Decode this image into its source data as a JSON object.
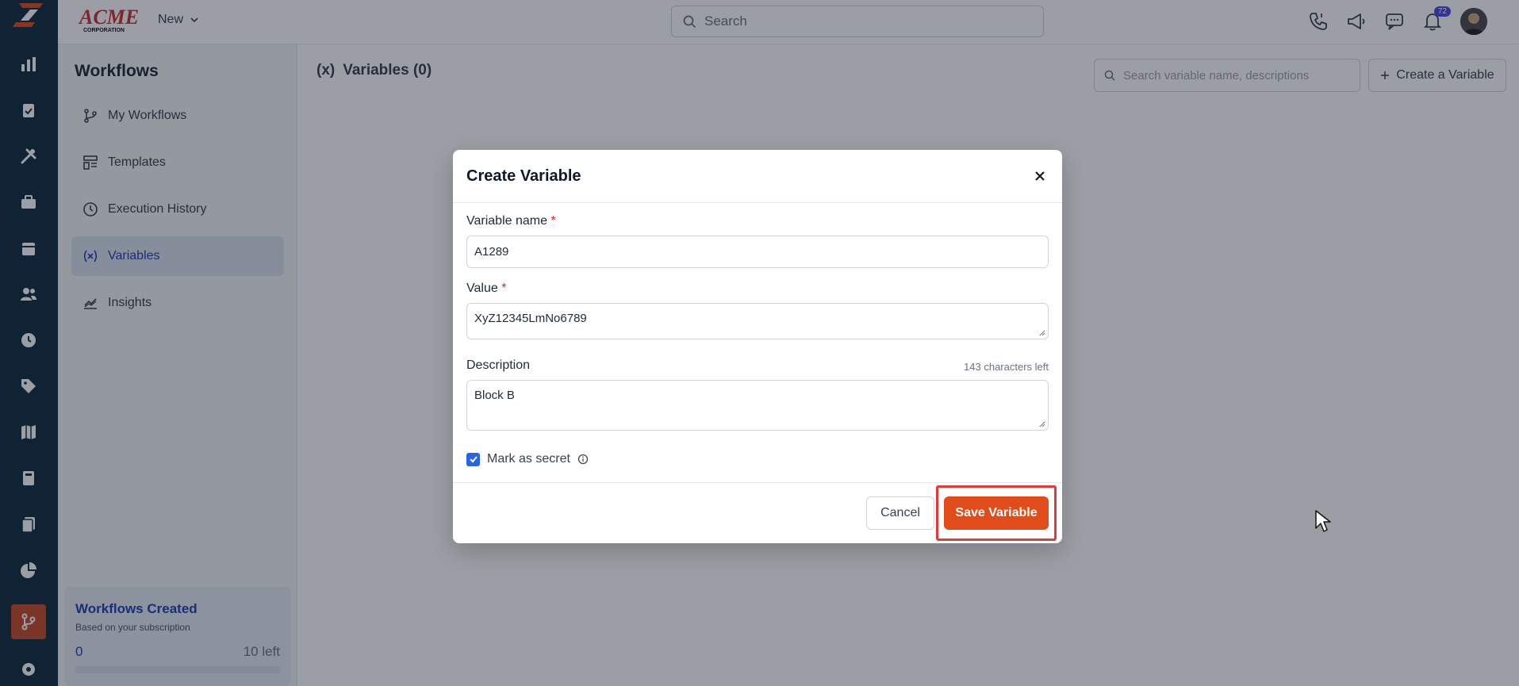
{
  "topbar": {
    "brand_name": "ACME",
    "brand_sub": "CORPORATION",
    "new_label": "New",
    "search_placeholder": "Search",
    "notification_count": "72"
  },
  "rail": {
    "items": [
      "dashboard-icon",
      "reports-icon",
      "tools-icon",
      "briefcase-icon",
      "calendar-icon",
      "users-icon",
      "clock-icon",
      "tag-icon",
      "map-icon",
      "calculator-icon",
      "documents-icon",
      "pie-chart-icon",
      "workflow-icon",
      "settings-icon"
    ],
    "active": "workflow-icon",
    "accent_color": "#c8492a"
  },
  "sidebar": {
    "title": "Workflows",
    "items": [
      {
        "label": "My Workflows",
        "icon": "branch-icon"
      },
      {
        "label": "Templates",
        "icon": "template-icon"
      },
      {
        "label": "Execution History",
        "icon": "history-icon"
      },
      {
        "label": "Variables",
        "icon": "variable-icon"
      },
      {
        "label": "Insights",
        "icon": "insights-icon"
      }
    ],
    "quota": {
      "title": "Workflows Created",
      "subtitle": "Based on your subscription",
      "count": "0",
      "left": "10 left",
      "progress": 0
    }
  },
  "main": {
    "title_icon": "(x)",
    "title": "Variables (0)",
    "search_placeholder": "Search variable name, descriptions",
    "create_label": "Create a Variable"
  },
  "modal": {
    "title": "Create Variable",
    "name_label": "Variable name",
    "name_value": "A1289",
    "value_label": "Value",
    "value_value": "XyZ12345LmNo6789",
    "description_label": "Description",
    "chars_left": "143 characters left",
    "description_value": "Block B",
    "secret_label": "Mark as secret",
    "secret_checked": true,
    "cancel_label": "Cancel",
    "save_label": "Save Variable",
    "save_color": "#e24c1a"
  }
}
